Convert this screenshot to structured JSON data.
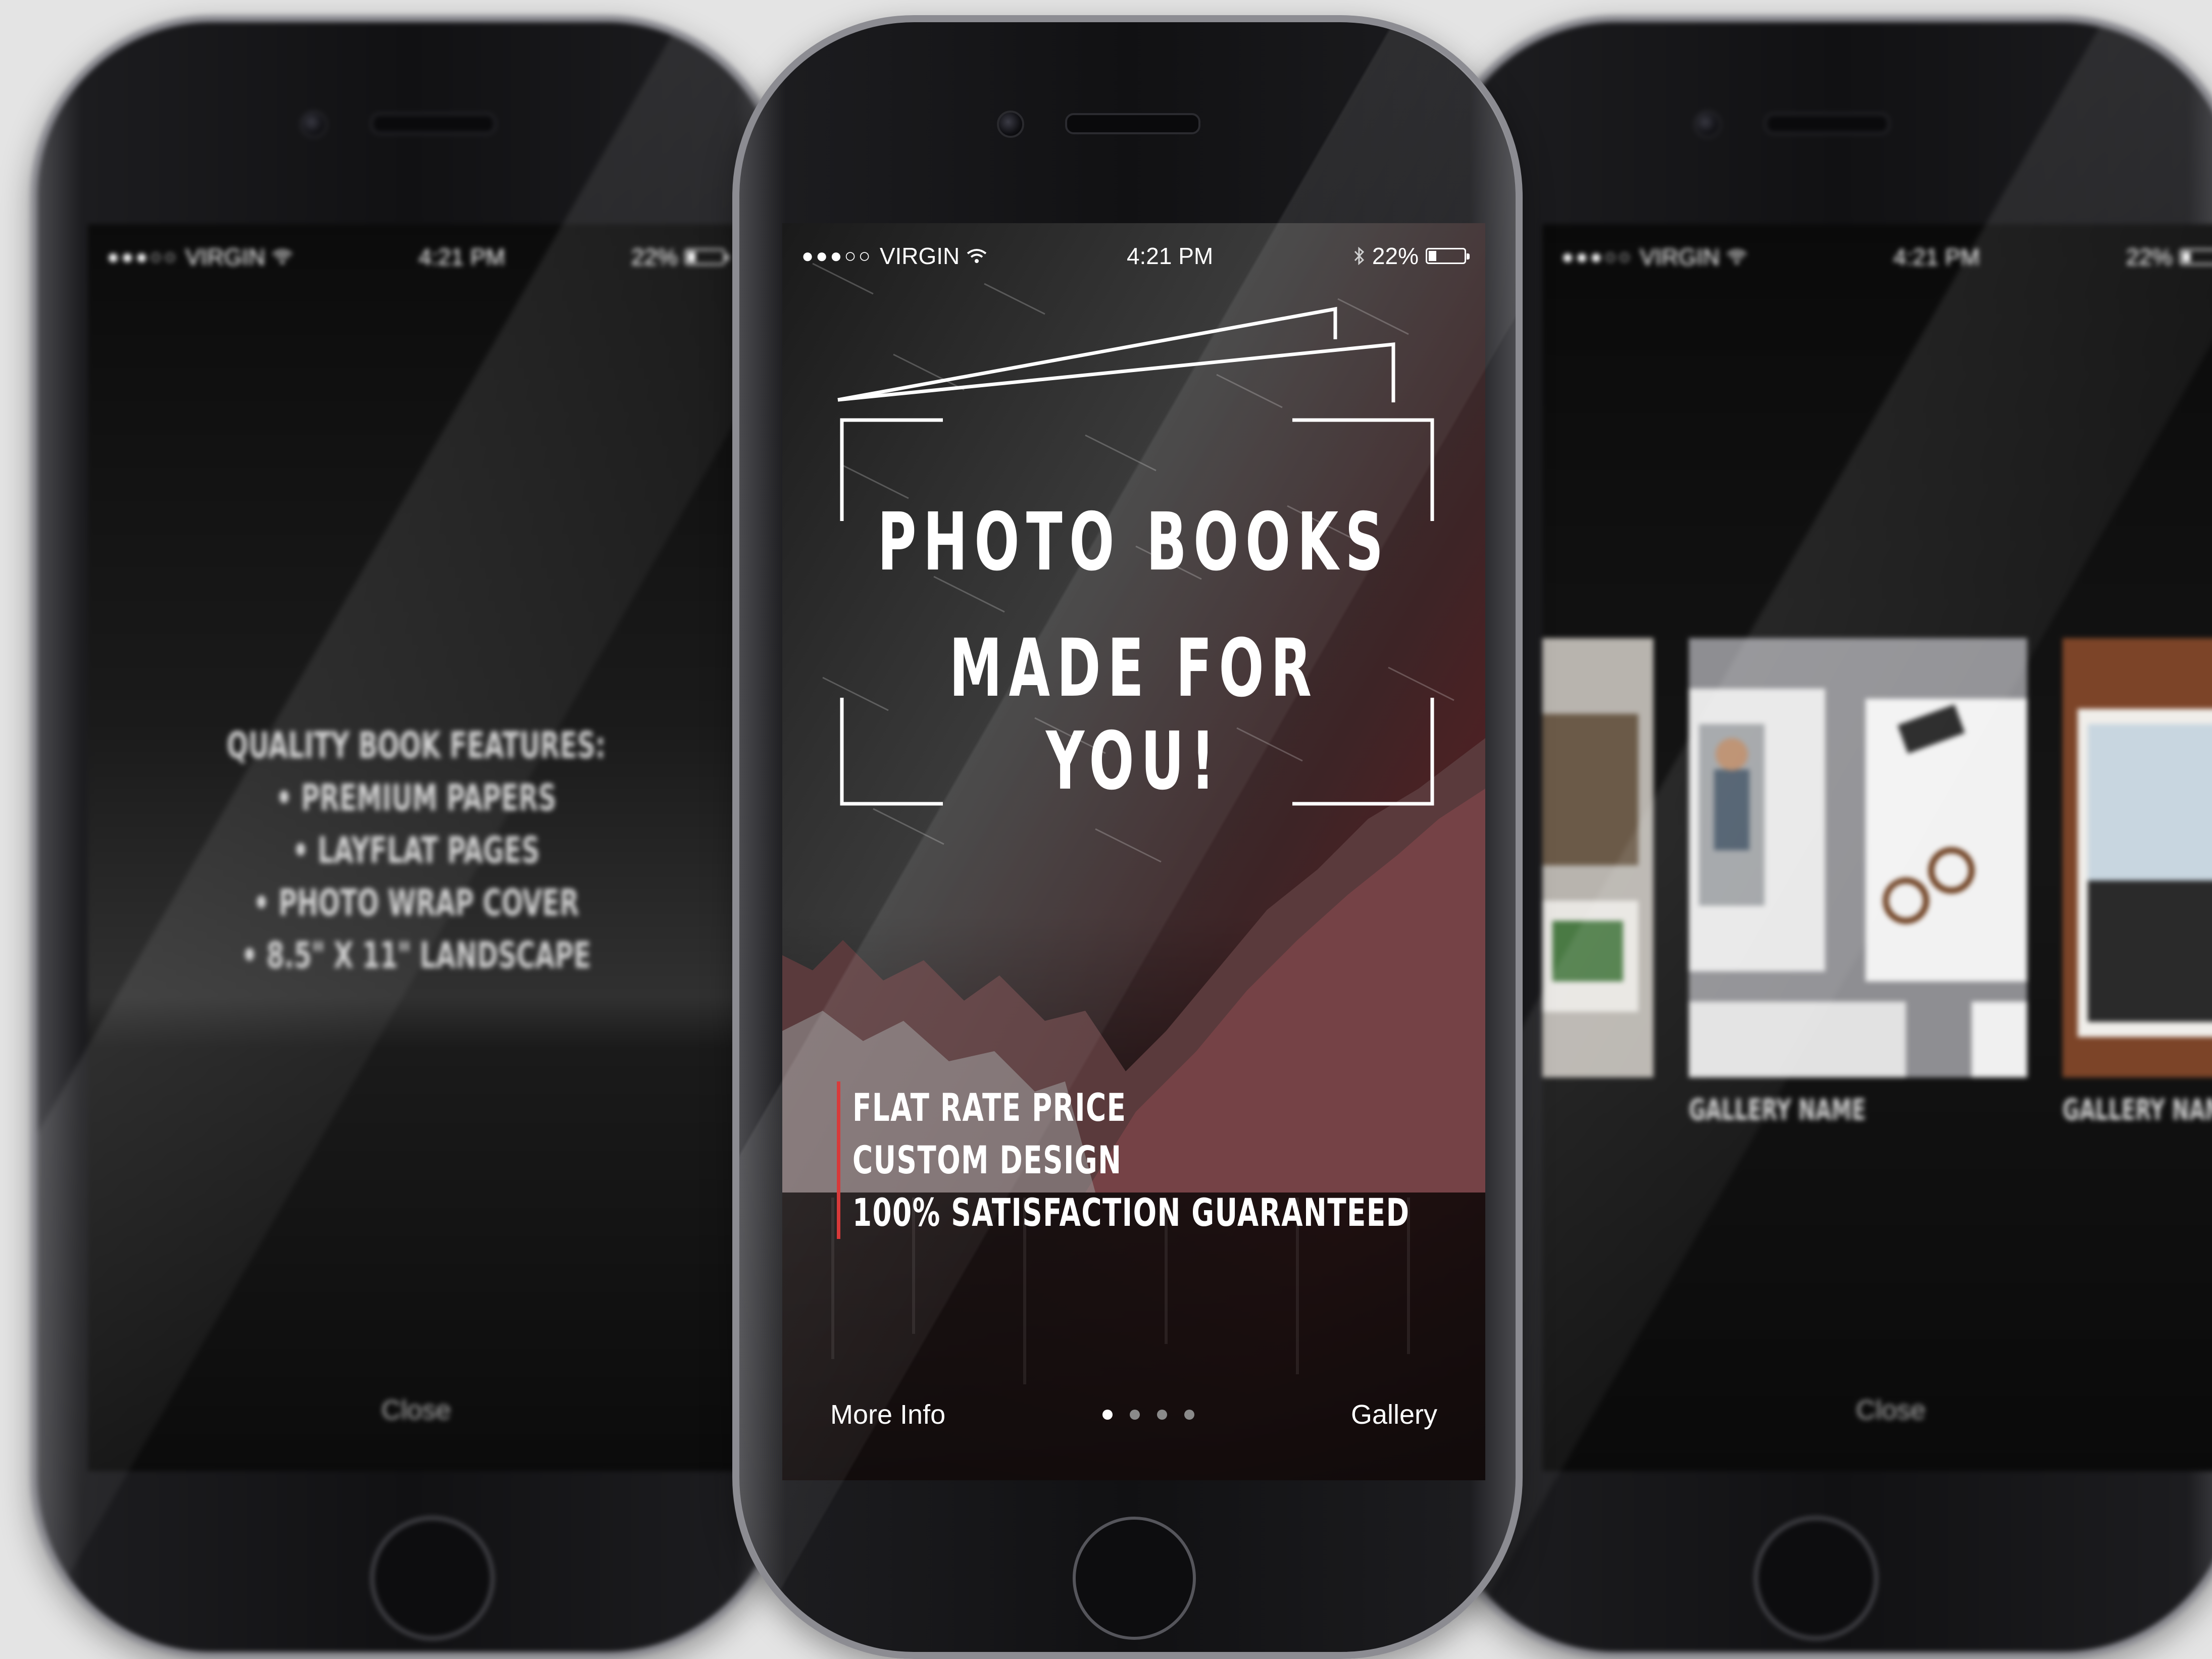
{
  "status_bar": {
    "signal": "●●●○○",
    "carrier": "VIRGIN",
    "time": "4:21 PM",
    "battery_text": "22%",
    "battery_level": 0.22
  },
  "center_screen": {
    "title_line1": "PHOTO BOOKS",
    "title_line2": "MADE FOR YOU!",
    "features": [
      "FLAT RATE PRICE",
      "CUSTOM DESIGN",
      "100% SATISFACTION GUARANTEED"
    ],
    "more_info": "More Info",
    "gallery": "Gallery",
    "page_count": 4,
    "current_page": 1,
    "accent_color": "#d42a2a"
  },
  "left_screen": {
    "heading": "QUALITY BOOK FEATURES:",
    "features": [
      "• PREMIUM PAPERS",
      "• LAYFLAT PAGES",
      "• PHOTO WRAP COVER",
      "• 8.5\" X 11\" LANDSCAPE"
    ],
    "close": "Close"
  },
  "right_screen": {
    "gallery_label_1": "GALLERY NAME",
    "gallery_label_2": "GALLERY NAME",
    "close": "Close"
  },
  "icons": [
    "wifi-icon",
    "bluetooth-icon",
    "battery-icon",
    "camera-icon",
    "home-button-icon"
  ]
}
